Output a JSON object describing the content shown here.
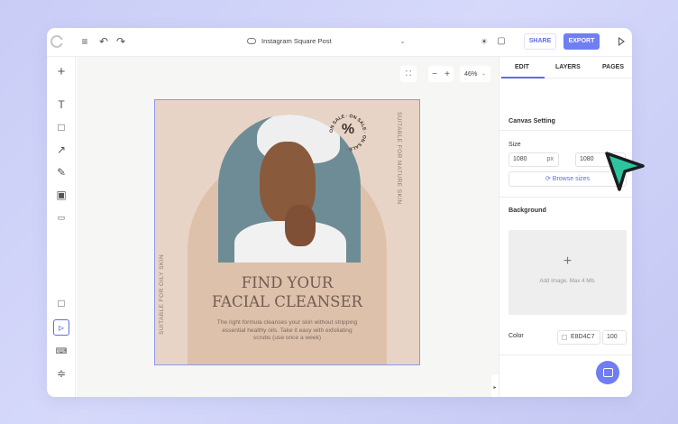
{
  "toolbar": {
    "doc_title": "Instagram Square Post",
    "share_label": "SHARE",
    "export_label": "EXPORT"
  },
  "left_tools": [
    "add",
    "text",
    "rectangle",
    "arrow",
    "pen",
    "image",
    "badge",
    "page",
    "select",
    "keyboard",
    "align"
  ],
  "canvas": {
    "zoom": "46%"
  },
  "poster": {
    "background_color": "#E8D4C7",
    "headline_line1": "FIND YOUR",
    "headline_line2": "FACIAL CLEANSER",
    "body": "The right formula cleanses your skin without stripping essential healthy oils. Take it easy with exfoliating scrubs (use once a week)",
    "side_left": "SUITABLE FOR OILY SKIN",
    "side_right": "SUITABLE FOR MATURE SKIN",
    "badge_symbol": "%",
    "badge_text": "ON SALE"
  },
  "panel": {
    "tabs": [
      "EDIT",
      "LAYERS",
      "PAGES"
    ],
    "canvas_setting_label": "Canvas Setting",
    "size_label": "Size",
    "width_value": "1080",
    "height_value": "1080",
    "unit": "px",
    "browse_label": "Browse sizes",
    "background_label": "Background",
    "add_image_hint": "Add Image. Max 4 Mb.",
    "color_label": "Color",
    "color_value": "E8D4C7",
    "opacity_value": "100"
  },
  "colors": {
    "accent": "#6f7ef2",
    "cursor": "#2ec4a0"
  }
}
